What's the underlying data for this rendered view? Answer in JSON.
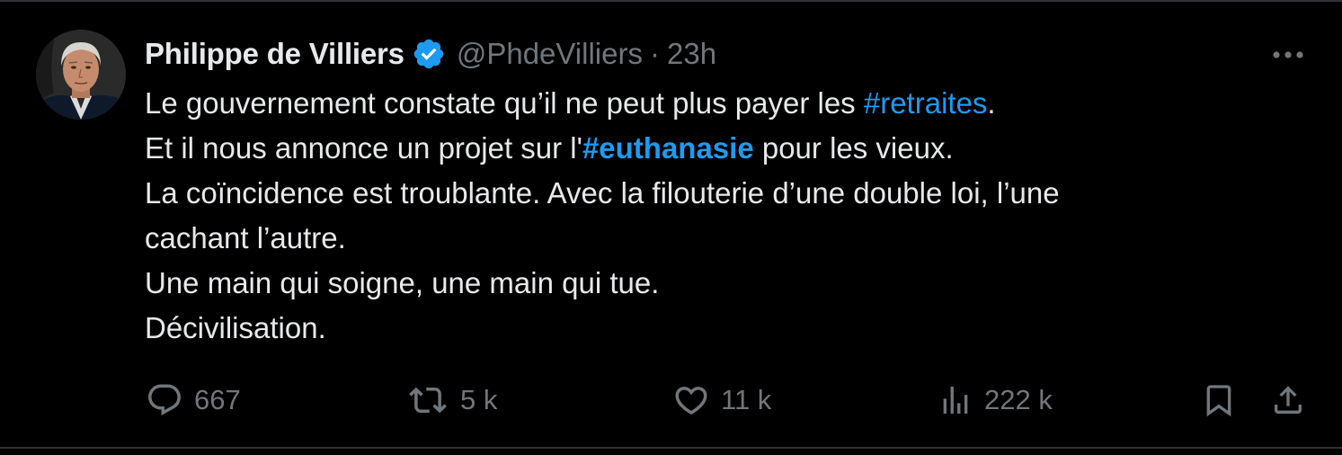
{
  "tweet": {
    "author": {
      "name": "Philippe de Villiers",
      "handle": "@PhdeVilliers",
      "verified": true,
      "avatar_icon": "profile-photo"
    },
    "separator": "·",
    "time": "23h",
    "more_icon": "more-horizontal-icon",
    "body": {
      "line1_pre": "Le gouvernement constate qu’il ne peut plus payer les ",
      "line1_tag": "#retraites",
      "line1_post": ".",
      "line2_pre": "Et il nous annonce un projet sur l'",
      "line2_tag": "#euthanasie",
      "line2_post": " pour les vieux.",
      "line3": "La coïncidence est troublante. Avec la filouterie d’une double loi, l’une",
      "line4": "cachant l’autre.",
      "line5": "Une main qui soigne, une main qui tue.",
      "line6": "Décivilisation."
    },
    "actions": {
      "replies": "667",
      "retweets": "5 k",
      "likes": "11 k",
      "views": "222 k"
    },
    "colors": {
      "background": "#000000",
      "text": "#e7e9ea",
      "muted": "#71767b",
      "accent": "#1d9bf0",
      "border": "#2f3336"
    }
  }
}
